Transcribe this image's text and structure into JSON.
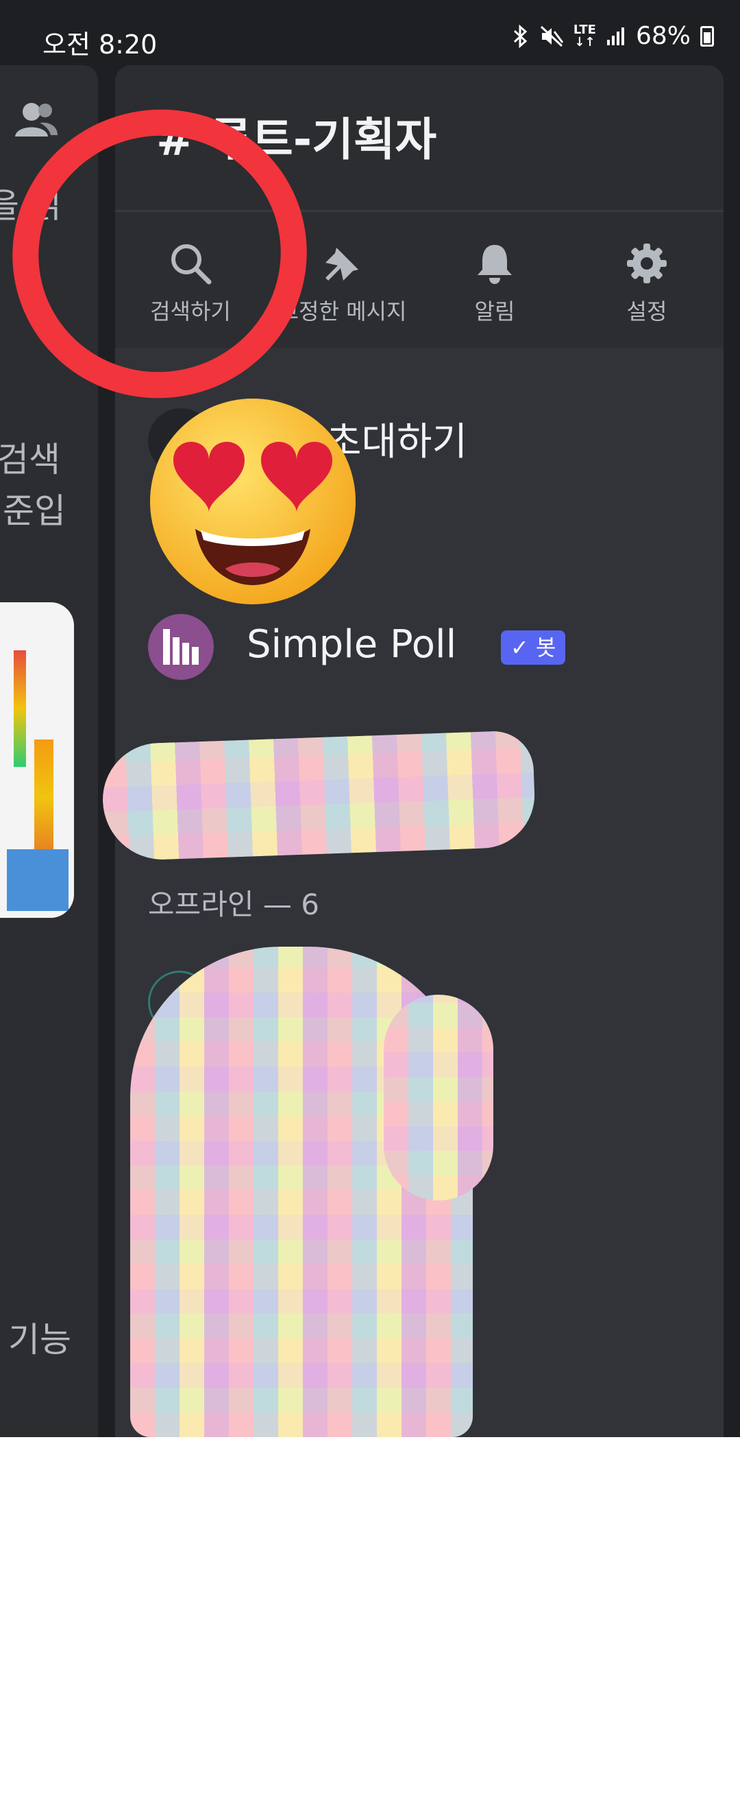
{
  "status_bar": {
    "time": "오전 8:20",
    "network": "LTE",
    "battery": "68%"
  },
  "left_panel": {
    "fragment_1": "을 읽",
    "fragment_2": "검색",
    "fragment_3": "준입",
    "fragment_4": "기능"
  },
  "channel": {
    "title": "#   루트-기획자"
  },
  "actions": [
    {
      "label": "검색하기",
      "icon": "search-icon"
    },
    {
      "label": "고정한 메시지",
      "icon": "pin-icon"
    },
    {
      "label": "알림",
      "icon": "bell-icon"
    },
    {
      "label": "설정",
      "icon": "gear-icon"
    }
  ],
  "invite": {
    "label": "초대하기"
  },
  "members": {
    "online_rows": [
      {
        "name": "Simple Poll",
        "badge": "✓ 봇"
      }
    ],
    "offline_header": "오프라인 — 6"
  },
  "overlays": {
    "circle_color": "#f2343c",
    "emoji": "smiling-face-with-heart-eyes"
  },
  "colors": {
    "background": "#1e1f22",
    "panel": "#313338",
    "bot_badge": "#5865f2",
    "text_primary": "#f2f3f5",
    "text_secondary": "#b5bac1"
  }
}
